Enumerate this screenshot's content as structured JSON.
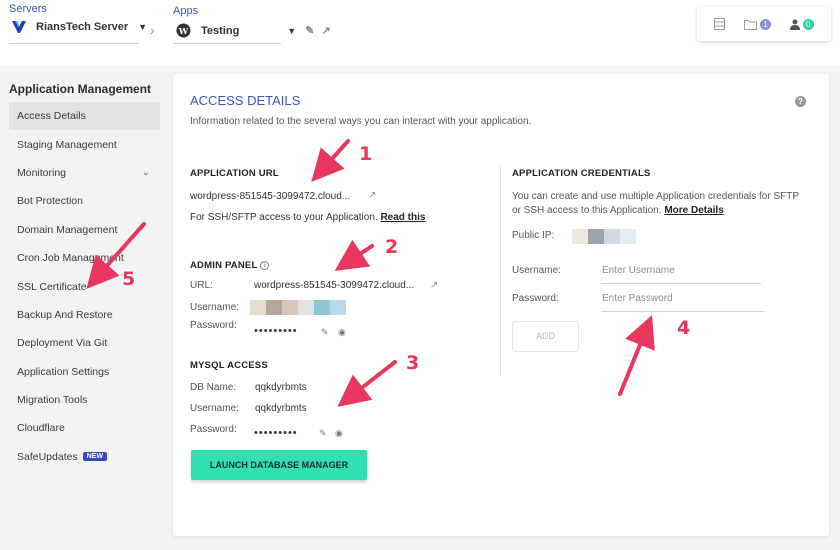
{
  "topbar": {
    "servers_label": "Servers",
    "server_name": "RiansTech Server",
    "apps_label": "Apps",
    "app_name": "Testing",
    "files_count": "1",
    "members_count": "0"
  },
  "sidebar": {
    "title": "Application Management",
    "items": [
      {
        "label": "Access Details"
      },
      {
        "label": "Staging Management"
      },
      {
        "label": "Monitoring"
      },
      {
        "label": "Bot Protection"
      },
      {
        "label": "Domain Management"
      },
      {
        "label": "Cron Job Management"
      },
      {
        "label": "SSL Certificate"
      },
      {
        "label": "Backup And Restore"
      },
      {
        "label": "Deployment Via Git"
      },
      {
        "label": "Application Settings"
      },
      {
        "label": "Migration Tools"
      },
      {
        "label": "Cloudflare"
      },
      {
        "label": "SafeUpdates"
      }
    ],
    "new_badge": "NEW"
  },
  "main": {
    "title": "ACCESS DETAILS",
    "subtitle": "Information related to the several ways you can interact with your application.",
    "app_url": {
      "heading": "APPLICATION URL",
      "url": "wordpress-851545-3099472.cloud...",
      "ssh_note": "For SSH/SFTP access to your Application.",
      "ssh_link": "Read this"
    },
    "admin_panel": {
      "heading": "ADMIN PANEL",
      "url_label": "URL:",
      "url": "wordpress-851545-3099472.cloud...",
      "username_label": "Username:",
      "password_label": "Password:",
      "password_mask": "•••••••••"
    },
    "mysql": {
      "heading": "MYSQL ACCESS",
      "db_label": "DB Name:",
      "db_name": "qqkdyrbmts",
      "username_label": "Username:",
      "username": "qqkdyrbmts",
      "password_label": "Password:",
      "password_mask": "•••••••••",
      "launch_button": "LAUNCH DATABASE MANAGER"
    },
    "credentials": {
      "heading": "APPLICATION CREDENTIALS",
      "description_line1": "You can create and use multiple Application credentials for SFTP",
      "description_line2": "or SSH access to this Application.",
      "details_link": "More Details",
      "public_ip_label": "Public IP:",
      "username_label": "Username:",
      "username_placeholder": "Enter Username",
      "password_label": "Password:",
      "password_placeholder": "Enter Password",
      "add_button": "ADD"
    }
  },
  "annotations": [
    "1",
    "2",
    "3",
    "4",
    "5"
  ],
  "colors": {
    "accent_blue": "#3d55b9",
    "launch_green": "#2fe0b0",
    "annotation_pink": "#e8365f",
    "new_badge": "#3b46c4"
  }
}
